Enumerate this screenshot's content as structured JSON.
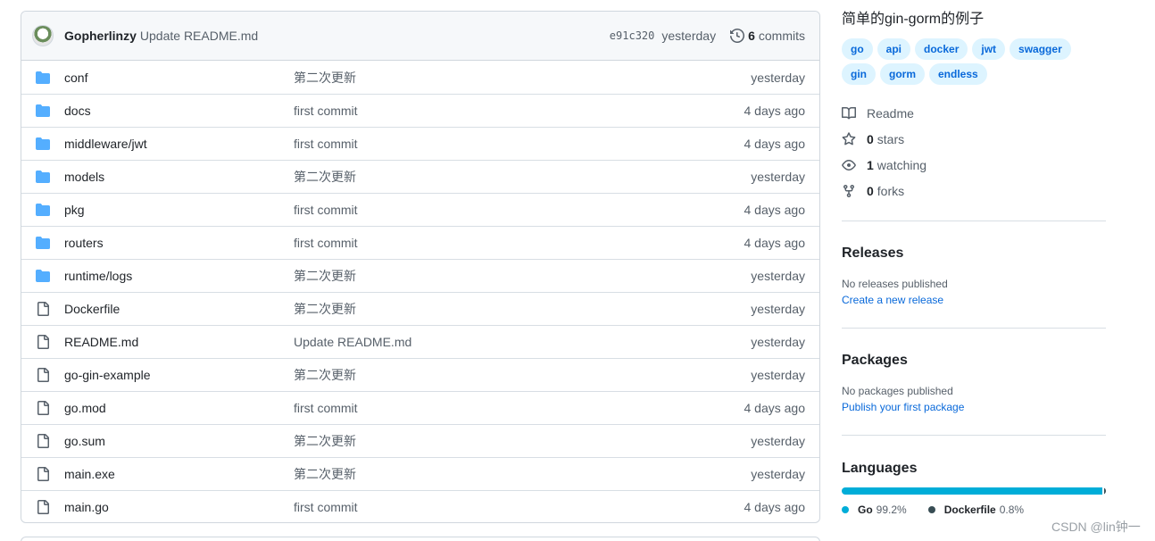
{
  "commit_bar": {
    "author": "Gopherlinzy",
    "message": "Update README.md",
    "sha": "e91c320",
    "time": "yesterday",
    "commit_count": "6",
    "commits_label": "commits"
  },
  "files": [
    {
      "name": "conf",
      "type": "folder",
      "commit": "第二次更新",
      "age": "yesterday"
    },
    {
      "name": "docs",
      "type": "folder",
      "commit": "first commit",
      "age": "4 days ago"
    },
    {
      "name": "middleware/jwt",
      "type": "folder",
      "commit": "first commit",
      "age": "4 days ago"
    },
    {
      "name": "models",
      "type": "folder",
      "commit": "第二次更新",
      "age": "yesterday"
    },
    {
      "name": "pkg",
      "type": "folder",
      "commit": "first commit",
      "age": "4 days ago"
    },
    {
      "name": "routers",
      "type": "folder",
      "commit": "first commit",
      "age": "4 days ago"
    },
    {
      "name": "runtime/logs",
      "type": "folder",
      "commit": "第二次更新",
      "age": "yesterday"
    },
    {
      "name": "Dockerfile",
      "type": "file",
      "commit": "第二次更新",
      "age": "yesterday"
    },
    {
      "name": "README.md",
      "type": "file",
      "commit": "Update README.md",
      "age": "yesterday"
    },
    {
      "name": "go-gin-example",
      "type": "file",
      "commit": "第二次更新",
      "age": "yesterday"
    },
    {
      "name": "go.mod",
      "type": "file",
      "commit": "first commit",
      "age": "4 days ago"
    },
    {
      "name": "go.sum",
      "type": "file",
      "commit": "第二次更新",
      "age": "yesterday"
    },
    {
      "name": "main.exe",
      "type": "file",
      "commit": "第二次更新",
      "age": "yesterday"
    },
    {
      "name": "main.go",
      "type": "file",
      "commit": "first commit",
      "age": "4 days ago"
    }
  ],
  "about": {
    "description": "简单的gin-gorm的例子",
    "topics": [
      "go",
      "api",
      "docker",
      "jwt",
      "swagger",
      "gin",
      "gorm",
      "endless"
    ],
    "readme_label": "Readme",
    "stars_count": "0",
    "stars_label": "stars",
    "watching_count": "1",
    "watching_label": "watching",
    "forks_count": "0",
    "forks_label": "forks"
  },
  "releases": {
    "title": "Releases",
    "empty_text": "No releases published",
    "create_link": "Create a new release"
  },
  "packages": {
    "title": "Packages",
    "empty_text": "No packages published",
    "publish_link": "Publish your first package"
  },
  "languages": {
    "title": "Languages",
    "items": [
      {
        "name": "Go",
        "percent_label": "99.2%",
        "percent": 99.2,
        "color": "#00add8"
      },
      {
        "name": "Dockerfile",
        "percent_label": "0.8%",
        "percent": 0.8,
        "color": "#384d54"
      }
    ]
  },
  "watermark": "CSDN @lin钟一",
  "colors": {
    "folder": "#54aeff",
    "link": "#0969da",
    "topic_bg": "#ddf4ff"
  }
}
